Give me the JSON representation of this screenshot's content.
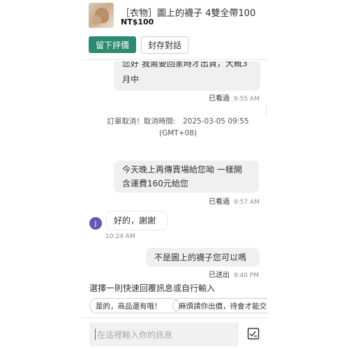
{
  "header": {
    "product_title": "［衣物］圖上的襪子 4雙全帶100",
    "price": "NT$100",
    "review_button": "留下評價",
    "archive_button": "封存對話"
  },
  "messages": [
    {
      "text_line1": "您好 我需要回家時才出貨，大概3",
      "text_line2": "月中",
      "status": "已看過",
      "time": "9:55 AM"
    },
    {
      "text_line1": "訂單取消！取消時間:　2025-03-05 09:55",
      "text_line2": "(GMT+08)"
    },
    {
      "text_line1": "今天晚上再傳賣場給您呦 一樣開",
      "text_line2": "含運費160元給您",
      "status": "已看過",
      "time": "9:57 AM"
    },
    {
      "avatar_letter": "J",
      "text": "好的，謝謝",
      "time": "10:24 AM"
    },
    {
      "text": "不是圖上的襪子您可以嗎",
      "status": "已送出",
      "time": "9:40 PM"
    }
  ],
  "quick_reply": {
    "prompt": "選擇一則快速回覆訊息或自行輸入",
    "chips": [
      "是的，商品還有哦！",
      "麻煩請你出價，待會才能交"
    ]
  },
  "composer": {
    "placeholder": "在這裡輸入你的訊息",
    "image_icon": "image-upload-icon"
  },
  "colors": {
    "accent": "#2b8a6f",
    "avatar": "#6a55b5",
    "bubble": "#f0f0f0"
  }
}
